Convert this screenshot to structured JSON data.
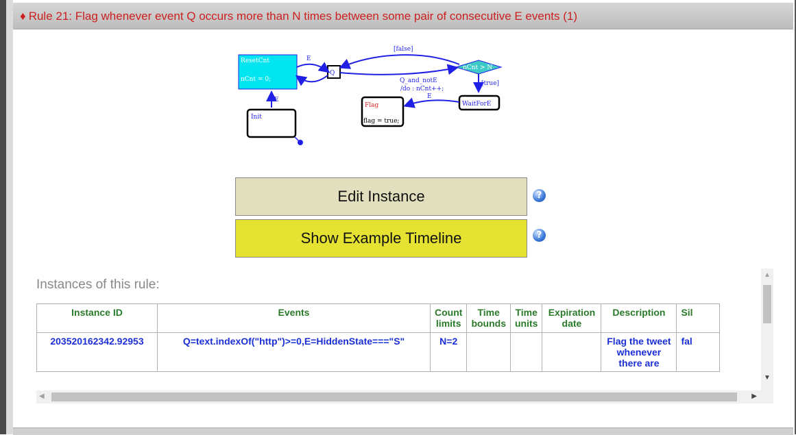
{
  "header": {
    "title": "Rule 21: Flag whenever event Q occurs more than N times between some pair of consecutive E events (1)",
    "bullet": "♦"
  },
  "diagram": {
    "nodes": {
      "resetcnt_name": "ResetCnt",
      "resetcnt_action": "nCnt = 0;",
      "q_name": "Q",
      "cond_name": "nCnt > N",
      "init_name": "Init",
      "flag_name": "Flag",
      "flag_action": "flag = true;",
      "waitfor_name": "WaitForE"
    },
    "edges": {
      "e_top": "E",
      "e_left": "E",
      "false_label": "[false]",
      "true_label": "[true]",
      "q_and_note_1": "Q_and_notE",
      "q_and_note_2": "/do : nCnt++;",
      "e_flag": "E"
    }
  },
  "buttons": {
    "edit_label": "Edit Instance",
    "timeline_label": "Show Example Timeline",
    "help_glyph": "?"
  },
  "instances": {
    "label": "Instances of this rule:",
    "columns": {
      "id": "Instance ID",
      "events": "Events",
      "count": "Count limits",
      "bounds": "Time bounds",
      "units": "Time units",
      "expiration": "Expiration date",
      "description": "Description",
      "silent": "Sil"
    },
    "rows": [
      {
        "id": "203520162342.92953",
        "events": "Q=text.indexOf(\"http\")>=0,E=HiddenState===\"S\"",
        "count": "N=2",
        "bounds": "",
        "units": "",
        "expiration": "",
        "description": "Flag the tweet whenever there are",
        "silent": "fal"
      }
    ]
  },
  "colors": {
    "title": "#cc2020",
    "header_text": "#2a7a2a",
    "cell_text": "#1b2fd6",
    "edit_button": "#e1dfbd",
    "timeline_button": "#e5e232",
    "diagram_blue": "#1f1fe6",
    "diagram_cyan": "#00e5f0"
  },
  "icons": {
    "help": "help-circle-icon",
    "scroll_up": "chevron-up-icon",
    "scroll_down": "chevron-down-icon",
    "scroll_left": "chevron-left-icon",
    "scroll_right": "chevron-right-icon"
  }
}
